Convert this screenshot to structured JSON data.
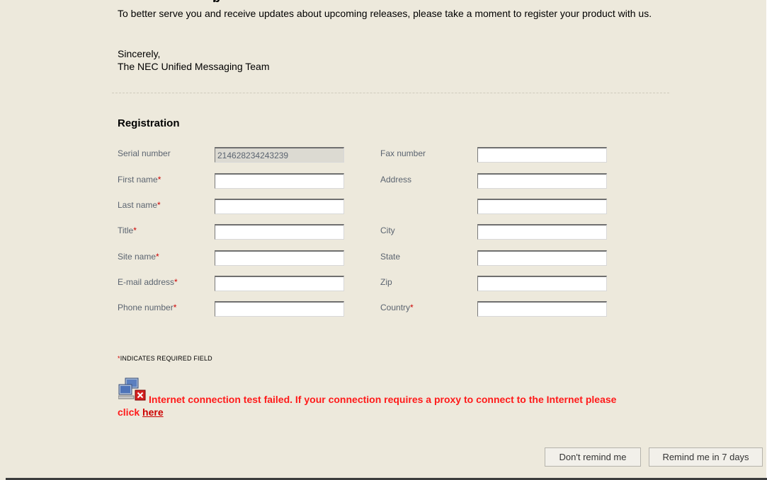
{
  "page": {
    "heading_clipped": "p",
    "intro": "To better serve you and receive updates about upcoming releases, please take a moment to register your product with us.",
    "signoff_line1": "Sincerely,",
    "signoff_line2": "The NEC Unified Messaging Team"
  },
  "registration": {
    "title": "Registration",
    "left_fields": [
      {
        "label": "Serial number",
        "required": false,
        "value": "214628234243239",
        "disabled": true
      },
      {
        "label": "First name",
        "required": true,
        "value": ""
      },
      {
        "label": "Last name",
        "required": true,
        "value": ""
      },
      {
        "label": "Title",
        "required": true,
        "value": ""
      },
      {
        "label": "Site name",
        "required": true,
        "value": ""
      },
      {
        "label": "E-mail address",
        "required": true,
        "value": ""
      },
      {
        "label": "Phone number",
        "required": true,
        "value": ""
      }
    ],
    "right_fields": [
      {
        "label": "Fax number",
        "required": false,
        "value": ""
      },
      {
        "label": "Address",
        "required": false,
        "value": ""
      },
      {
        "label": "",
        "required": false,
        "value": ""
      },
      {
        "label": "City",
        "required": false,
        "value": ""
      },
      {
        "label": "State",
        "required": false,
        "value": ""
      },
      {
        "label": "Zip",
        "required": false,
        "value": ""
      },
      {
        "label": "Country",
        "required": true,
        "value": ""
      }
    ],
    "required_marker": "*",
    "required_note": "INDICATES REQUIRED FIELD"
  },
  "error": {
    "message": "Internet connection test failed. If your connection requires a proxy to connect to the Internet please click",
    "link_text": "here"
  },
  "buttons": {
    "dont_remind": "Don't remind me",
    "remind_7_days": "Remind me in 7 days"
  },
  "colors": {
    "background": "#ede9dc",
    "label_text": "#5b6470",
    "required_marker": "#cc0000",
    "error_text": "#ff1a1a"
  }
}
